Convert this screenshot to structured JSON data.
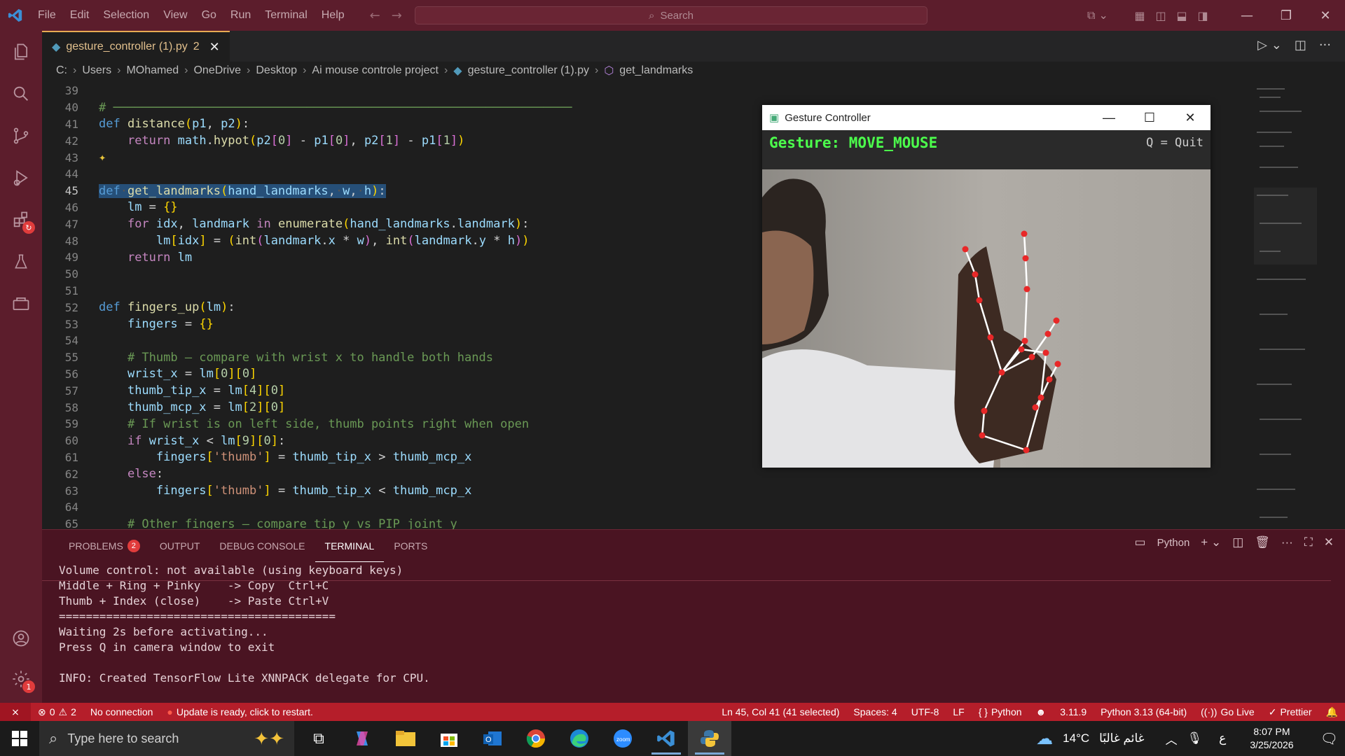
{
  "menu": [
    "File",
    "Edit",
    "Selection",
    "View",
    "Go",
    "Run",
    "Terminal",
    "Help"
  ],
  "search": {
    "placeholder": "Search"
  },
  "tab": {
    "filename": "gesture_controller (1).py",
    "problems": "2"
  },
  "breadcrumb": [
    "C:",
    "Users",
    "MOhamed",
    "OneDrive",
    "Desktop",
    "Ai mouse controle project",
    "gesture_controller (1).py",
    "get_landmarks"
  ],
  "code_lines": [
    {
      "n": "39"
    },
    {
      "n": "40"
    },
    {
      "n": "41"
    },
    {
      "n": "42"
    },
    {
      "n": "43"
    },
    {
      "n": "44"
    },
    {
      "n": "45"
    },
    {
      "n": "46"
    },
    {
      "n": "47"
    },
    {
      "n": "48"
    },
    {
      "n": "49"
    },
    {
      "n": "50"
    },
    {
      "n": "51"
    },
    {
      "n": "52"
    },
    {
      "n": "53"
    },
    {
      "n": "54"
    },
    {
      "n": "55"
    },
    {
      "n": "56"
    },
    {
      "n": "57"
    },
    {
      "n": "58"
    },
    {
      "n": "59"
    },
    {
      "n": "60"
    },
    {
      "n": "61"
    },
    {
      "n": "62"
    },
    {
      "n": "63"
    },
    {
      "n": "64"
    },
    {
      "n": "65"
    }
  ],
  "code": {
    "l40": "# ────────────────────────────────────────────────────────────────",
    "l41_def": "def",
    "l41_fn": "distance",
    "l41_p1": "p1",
    "l41_p2": "p2",
    "l42": [
      "return",
      "math",
      "hypot",
      "p2",
      "0",
      "p1",
      "0",
      "p2",
      "1",
      "p1",
      "1"
    ],
    "l45_def": "def",
    "l45_fn": "get_landmarks",
    "l45_a": "hand_landmarks",
    "l45_b": "w",
    "l45_c": "h",
    "l46_v": "lm",
    "l47": [
      "for",
      "idx",
      "landmark",
      "in",
      "enumerate",
      "hand_landmarks",
      "landmark"
    ],
    "l48": [
      "lm",
      "idx",
      "int",
      "landmark",
      "x",
      "w",
      "int",
      "landmark",
      "y",
      "h"
    ],
    "l49": [
      "return",
      "lm"
    ],
    "l52_def": "def",
    "l52_fn": "fingers_up",
    "l52_p": "lm",
    "l53": "fingers",
    "l55": "# Thumb — compare with wrist x to handle both hands",
    "l56": [
      "wrist_x",
      "lm",
      "0",
      "0"
    ],
    "l57": [
      "thumb_tip_x",
      "lm",
      "4",
      "0"
    ],
    "l58": [
      "thumb_mcp_x",
      "lm",
      "2",
      "0"
    ],
    "l59": "# If wrist is on left side, thumb points right when open",
    "l60": [
      "if",
      "wrist_x",
      "lm",
      "9",
      "0"
    ],
    "l61": [
      "fingers",
      "'thumb'",
      "thumb_tip_x",
      "thumb_mcp_x"
    ],
    "l62": "else",
    "l63": [
      "fingers",
      "'thumb'",
      "thumb_tip_x",
      "thumb_mcp_x"
    ],
    "l65": "# Other fingers — compare tip y vs PIP joint y"
  },
  "camera": {
    "title": "Gesture Controller",
    "gesture": "Gesture: MOVE_MOUSE",
    "quit": "Q = Quit"
  },
  "panel": {
    "tabs": [
      "PROBLEMS",
      "OUTPUT",
      "DEBUG CONSOLE",
      "TERMINAL",
      "PORTS"
    ],
    "problems_count": "2",
    "shell": "Python",
    "terminal": [
      "Volume control: not available (using keyboard keys)",
      "Middle + Ring + Pinky    -> Copy  Ctrl+C",
      "Thumb + Index (close)    -> Paste Ctrl+V",
      "=========================================",
      "Waiting 2s before activating...",
      "Press Q in camera window to exit",
      "",
      "INFO: Created TensorFlow Lite XNNPACK delegate for CPU."
    ]
  },
  "status": {
    "errors": "0",
    "warnings": "2",
    "connection": "No connection",
    "update": "Update is ready, click to restart.",
    "position": "Ln 45, Col 41 (41 selected)",
    "spaces": "Spaces: 4",
    "encoding": "UTF-8",
    "eol": "LF",
    "language": "Python",
    "version": "3.11.9",
    "interpreter": "Python 3.13 (64-bit)",
    "golive": "Go Live",
    "prettier": "Prettier"
  },
  "taskbar": {
    "search": "Type here to search",
    "weather": "14°C",
    "weather_text": "غائم غالبًا",
    "lang": "ع",
    "time": "8:07 PM",
    "date": "3/25/2026"
  },
  "colors": {
    "accent": "#5c1d2c",
    "status": "#b51e2a",
    "gesture": "#4cff4c"
  }
}
